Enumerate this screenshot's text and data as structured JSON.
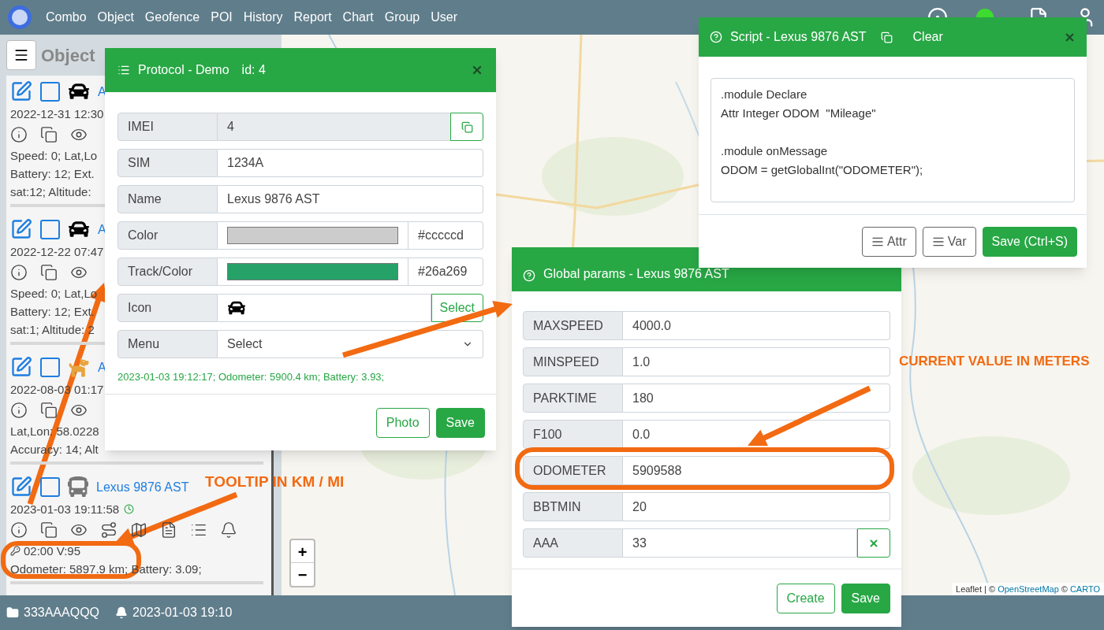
{
  "nav": {
    "items": [
      "Combo",
      "Object",
      "Geofence",
      "POI",
      "History",
      "Report",
      "Chart",
      "Group",
      "User"
    ]
  },
  "object_panel": {
    "title": "Object",
    "objects": [
      {
        "kind": "car",
        "name": "A",
        "checked": false,
        "date": "2022-12-31 12:30",
        "clock": false,
        "lines": [
          {
            "kind": "plain",
            "text": "Speed: 0; Lat,Lo"
          },
          {
            "kind": "plain",
            "text": "Battery: 12; Ext."
          },
          {
            "kind": "plain",
            "text": "sat:12; Altitude:"
          }
        ]
      },
      {
        "kind": "car",
        "name": "A",
        "checked": false,
        "date": "2022-12-22 07:47",
        "clock": false,
        "lines": [
          {
            "kind": "plain",
            "text": "Speed: 0; Lat,Lo"
          },
          {
            "kind": "plain",
            "text": "Battery: 12; Ext."
          },
          {
            "kind": "plain",
            "text": "sat:1; Altitude: 2"
          }
        ]
      },
      {
        "kind": "dog",
        "name": "A",
        "checked": false,
        "date": "2022-08-03 01:17",
        "clock": false,
        "lines": [
          {
            "kind": "plain",
            "text": "Lat,Lon: 58.0228"
          },
          {
            "kind": "plain",
            "text": "Accuracy: 14; Alt"
          }
        ]
      },
      {
        "kind": "van",
        "name": "Lexus 9876 AST",
        "checked": false,
        "date": "2023-01-03 19:11:58",
        "clock": true,
        "lines": [
          {
            "kind": "key",
            "text": "02:00 V:95"
          },
          {
            "kind": "plain",
            "text": "Odometer: 5897.9 km; Battery: 3.09;"
          }
        ]
      }
    ]
  },
  "protocol_dialog": {
    "title": "Protocol - Demo",
    "id_label": "id: 4",
    "fields": [
      {
        "label": "IMEI",
        "kind": "readonly",
        "value": "4"
      },
      {
        "label": "SIM",
        "kind": "text",
        "value": "1234A"
      },
      {
        "label": "Name",
        "kind": "text",
        "value": "Lexus 9876 AST"
      },
      {
        "label": "Color",
        "kind": "color",
        "color": "#cccccd",
        "value": "#cccccd"
      },
      {
        "label": "Track/Color",
        "kind": "color",
        "color": "#26a269",
        "value": "#26a269"
      },
      {
        "label": "Icon",
        "kind": "icon",
        "button": "Select"
      },
      {
        "label": "Menu",
        "kind": "select",
        "value": "Select"
      }
    ],
    "status": "2023-01-03 19:12:17; Odometer: 5900.4 km; Battery: 3.93;",
    "buttons": [
      {
        "label": "Photo",
        "kind": "outline"
      },
      {
        "label": "Save",
        "kind": "primary"
      }
    ]
  },
  "global_params_dialog": {
    "title": "Global params - Lexus 9876 AST",
    "params": [
      {
        "name": "MAXSPEED",
        "value": "4000.0",
        "removable": false
      },
      {
        "name": "MINSPEED",
        "value": "1.0",
        "removable": false
      },
      {
        "name": "PARKTIME",
        "value": "180",
        "removable": false
      },
      {
        "name": "F100",
        "value": "0.0",
        "removable": false
      },
      {
        "name": "ODOMETER",
        "value": "5909588",
        "removable": false
      },
      {
        "name": "BBTMIN",
        "value": "20",
        "removable": false
      },
      {
        "name": "AAA",
        "value": "33",
        "removable": true
      }
    ],
    "buttons": [
      {
        "label": "Create",
        "kind": "outline"
      },
      {
        "label": "Save",
        "kind": "primary"
      }
    ]
  },
  "script_dialog": {
    "title": "Script - Lexus 9876 AST",
    "clear": "Clear",
    "code": ".module Declare\nAttr Integer ODOM  \"Mileage\"\n\n.module onMessage\nODOM = getGlobalInt(\"ODOMETER\");",
    "buttons": [
      {
        "label": "Attr",
        "kind": "menu"
      },
      {
        "label": "Var",
        "kind": "menu"
      },
      {
        "label": "Save (Ctrl+S)",
        "kind": "primary"
      }
    ]
  },
  "map": {
    "zoom_in": "+",
    "zoom_out": "−",
    "attribution": [
      {
        "kind": "plain",
        "text": "Leaflet | ©"
      },
      {
        "kind": "link",
        "text": "OpenStreetMap"
      },
      {
        "kind": "plain",
        "text": "©"
      },
      {
        "kind": "link",
        "text": "CARTO"
      }
    ]
  },
  "status_bar": {
    "folder": "333AAAQQQ",
    "alert_time": "2023-01-03 19:10"
  },
  "annotations": {
    "labels": [
      "TOOLTIP IN KM / MI",
      "CURRENT VALUE IN METERS"
    ]
  }
}
